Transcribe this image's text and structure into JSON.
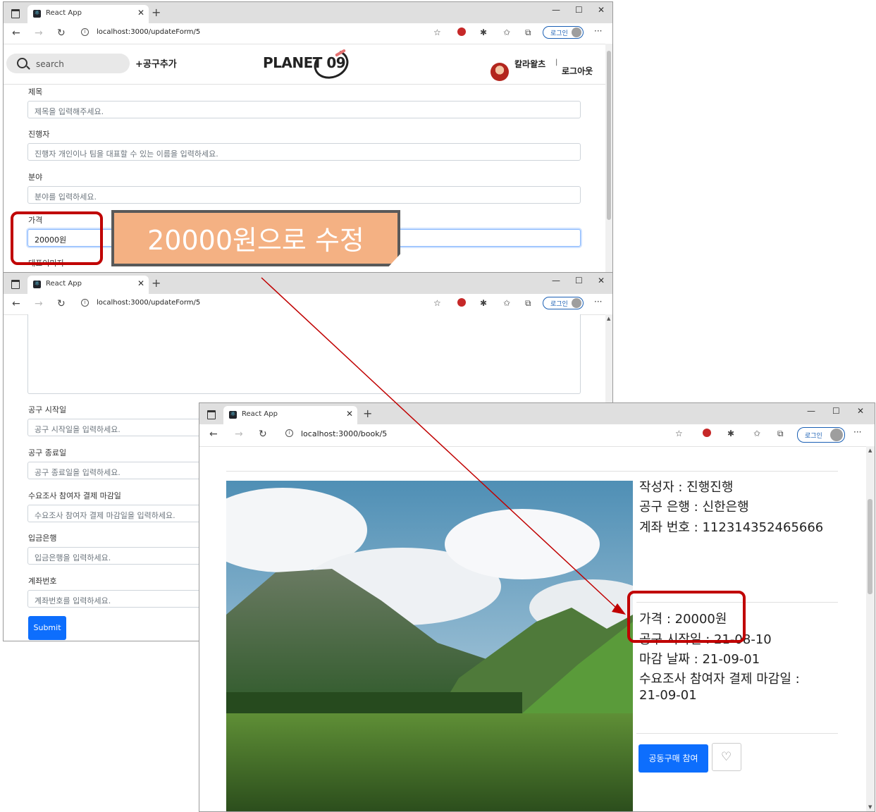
{
  "browser": {
    "tab_title": "React App",
    "login_label": "로그인"
  },
  "win1": {
    "url": "localhost:3000/updateForm/5",
    "header": {
      "search_placeholder": "search",
      "add_link": "+공구추가",
      "logo": "PLANET 09",
      "user_name": "칼라왈츠",
      "separator": "|",
      "logout": "로그아웃"
    },
    "fields": [
      {
        "label": "제목",
        "placeholder": "제목을 입력해주세요."
      },
      {
        "label": "진행자",
        "placeholder": "진행자 개인이나 팀을 대표할 수 있는 이름을 입력하세요."
      },
      {
        "label": "분야",
        "placeholder": "분야를 입력하세요."
      },
      {
        "label": "가격",
        "value": "20000원"
      }
    ],
    "cut_label": "대표이미지"
  },
  "win2": {
    "url": "localhost:3000/updateForm/5",
    "fields": [
      {
        "label": "공구 시작일",
        "placeholder": "공구 시작일을 입력하세요."
      },
      {
        "label": "공구 종료일",
        "placeholder": "공구 종료일을 입력하세요."
      },
      {
        "label": "수요조사 참여자 결제 마감일",
        "placeholder": "수요조사 참여자 결제 마감일을 입력하세요."
      },
      {
        "label": "입금은행",
        "placeholder": "입금은행을 입력하세요."
      },
      {
        "label": "계좌번호",
        "placeholder": "계좌번호를 입력하세요."
      }
    ],
    "submit": "Submit"
  },
  "win3": {
    "url": "localhost:3000/book/5",
    "info_top": [
      "작성자 : 진행진행",
      "공구 은행 : 신한은행",
      "계좌 번호 : 112314352465666"
    ],
    "info_mid": [
      "가격 : 20000원",
      "공구 시작일 : 21-08-10",
      "마감 날짜 : 21-09-01",
      "수요조사 참여자 결제 마감일 :",
      "21-09-01"
    ],
    "join_button": "공동구매 참여",
    "heart_icon": "♡"
  },
  "annotation": {
    "callout": "20000원으로 수정"
  },
  "colors": {
    "highlight_red": "#c00000",
    "callout_fill": "#f4b183",
    "primary": "#0d6efd"
  }
}
